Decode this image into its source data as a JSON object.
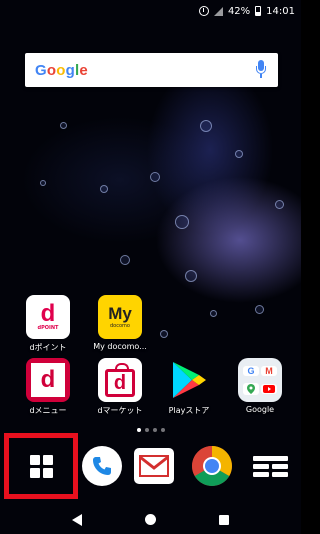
{
  "status_bar": {
    "battery": "42%",
    "time": "14:01",
    "icons": [
      "alarm-icon",
      "signal-icon",
      "battery-icon"
    ]
  },
  "search": {
    "logo_text": "Google",
    "icon": "mic-icon"
  },
  "home_apps": [
    {
      "name": "dポイント",
      "icon": "dpoint-icon",
      "icon_text": "d",
      "icon_subtext": "dPOINT"
    },
    {
      "name": "My docomo...",
      "icon": "my-docomo-icon",
      "icon_text": "My",
      "icon_subtext": "docomo"
    },
    {
      "name": "dメニュー",
      "icon": "dmenu-icon",
      "icon_text": "d"
    },
    {
      "name": "dマーケット",
      "icon": "dmarket-icon",
      "icon_text": "d"
    },
    {
      "name": "Playストア",
      "icon": "play-store-icon"
    },
    {
      "name": "Google",
      "icon": "google-folder-icon",
      "folder_cells": [
        "G",
        "M",
        "",
        ""
      ]
    }
  ],
  "page_indicator": {
    "count": 4,
    "active": 1
  },
  "dock": [
    {
      "name": "app-drawer",
      "icon": "app-drawer-grid-icon",
      "highlight_color": "#e8101e"
    },
    {
      "name": "phone",
      "icon": "phone-icon"
    },
    {
      "name": "mail",
      "icon": "mail-icon"
    },
    {
      "name": "chrome",
      "icon": "chrome-icon"
    },
    {
      "name": "menu",
      "icon": "menu-grid-icon"
    }
  ],
  "nav_bar": {
    "icons": [
      "back-icon",
      "home-icon",
      "recents-icon"
    ]
  }
}
